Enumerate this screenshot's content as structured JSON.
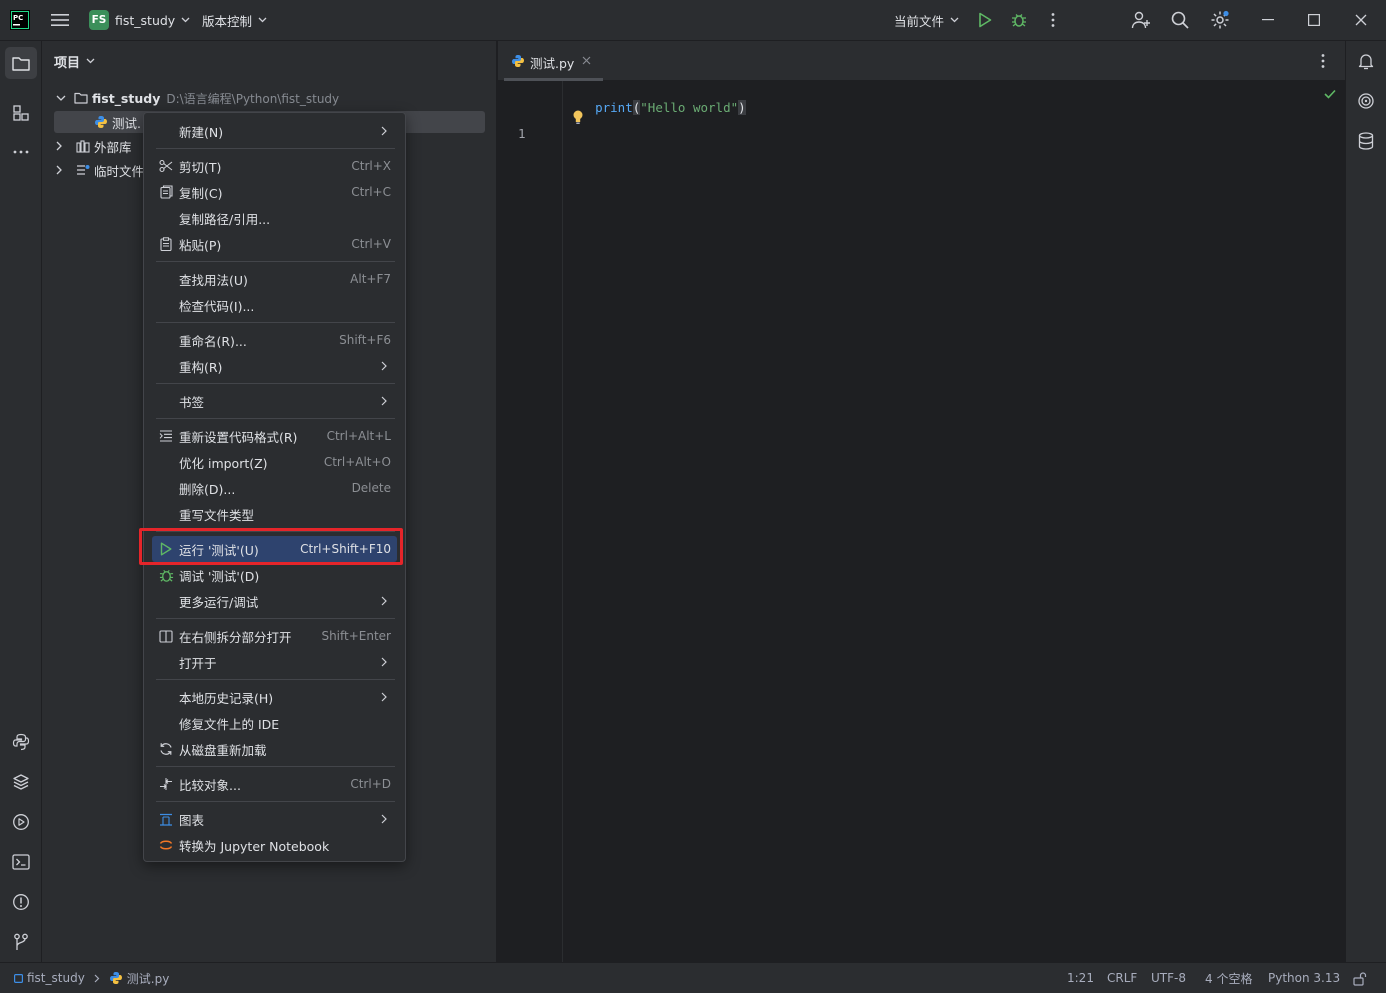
{
  "titlebar": {
    "project_badge": "FS",
    "project_name": "fist_study",
    "vcs_label": "版本控制",
    "run_config": "当前文件"
  },
  "project_panel": {
    "title": "项目",
    "root_name": "fist_study",
    "root_path": "D:\\语言编程\\Python\\fist_study",
    "file_name": "测试.py",
    "file_name_truncated": "测试.",
    "external_libs": "外部库",
    "scratches": "临时文件"
  },
  "editor": {
    "tab_name": "测试.py",
    "line_number": "1",
    "code_func": "print",
    "code_paren_open": "(",
    "code_string": "\"Hello world\"",
    "code_paren_close": ")"
  },
  "context_menu": {
    "items": [
      {
        "label": "新建(N)",
        "shortcut": "",
        "submenu": true
      },
      {
        "label": "剪切(T)",
        "shortcut": "Ctrl+X",
        "icon": "scissors-icon"
      },
      {
        "label": "复制(C)",
        "shortcut": "Ctrl+C",
        "icon": "copy-icon"
      },
      {
        "label": "复制路径/引用...",
        "shortcut": ""
      },
      {
        "label": "粘贴(P)",
        "shortcut": "Ctrl+V",
        "icon": "paste-icon"
      },
      {
        "label": "查找用法(U)",
        "shortcut": "Alt+F7"
      },
      {
        "label": "检查代码(I)...",
        "shortcut": ""
      },
      {
        "label": "重命名(R)...",
        "shortcut": "Shift+F6"
      },
      {
        "label": "重构(R)",
        "shortcut": "",
        "submenu": true
      },
      {
        "label": "书签",
        "shortcut": "",
        "submenu": true
      },
      {
        "label": "重新设置代码格式(R)",
        "shortcut": "Ctrl+Alt+L",
        "icon": "reformat-icon"
      },
      {
        "label": "优化 import(Z)",
        "shortcut": "Ctrl+Alt+O"
      },
      {
        "label": "删除(D)...",
        "shortcut": "Delete"
      },
      {
        "label": "重写文件类型",
        "shortcut": ""
      },
      {
        "label": "运行 '测试'(U)",
        "shortcut": "Ctrl+Shift+F10",
        "icon": "run-icon",
        "active": true
      },
      {
        "label": "调试 '测试'(D)",
        "shortcut": "",
        "icon": "debug-icon"
      },
      {
        "label": "更多运行/调试",
        "shortcut": "",
        "submenu": true
      },
      {
        "label": "在右侧拆分部分打开",
        "shortcut": "Shift+Enter",
        "icon": "split-icon"
      },
      {
        "label": "打开于",
        "shortcut": "",
        "submenu": true
      },
      {
        "label": "本地历史记录(H)",
        "shortcut": "",
        "submenu": true
      },
      {
        "label": "修复文件上的 IDE",
        "shortcut": ""
      },
      {
        "label": "从磁盘重新加载",
        "shortcut": "",
        "icon": "reload-icon"
      },
      {
        "label": "比较对象...",
        "shortcut": "Ctrl+D",
        "icon": "compare-icon"
      },
      {
        "label": "图表",
        "shortcut": "",
        "submenu": true,
        "icon": "diagram-icon"
      },
      {
        "label": "转换为 Jupyter Notebook",
        "shortcut": "",
        "icon": "jupyter-icon"
      }
    ]
  },
  "statusbar": {
    "crumb_project": "fist_study",
    "crumb_file": "测试.py",
    "position": "1:21",
    "line_sep": "CRLF",
    "encoding": "UTF-8",
    "indent": "4 个空格",
    "interpreter": "Python 3.13"
  },
  "colors": {
    "accent_run": "#5fb865",
    "selection": "#2e436e",
    "highlight_box": "#e5252a",
    "keyword_func": "#56a8f5",
    "string": "#6aab73"
  }
}
